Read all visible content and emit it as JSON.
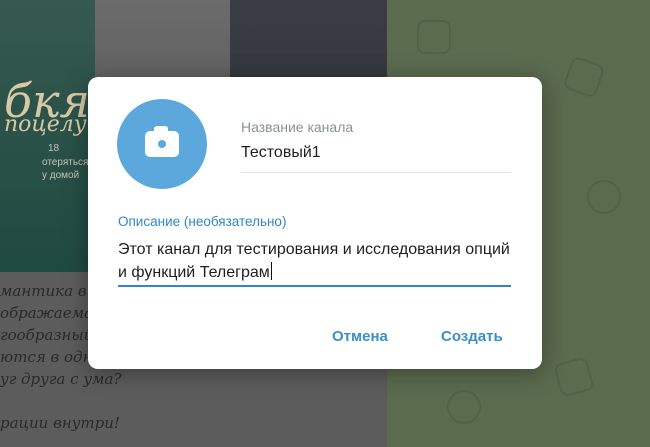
{
  "background": {
    "book_title_line1": "бкя",
    "book_title_line2": "поцелуй",
    "book_number": "18",
    "book_subtitle": "отеряться, чтоб\nу домой",
    "text_lines": [
      "мантика в д",
      "ображаемая",
      "гообразный",
      "ются в одн",
      "уг друга с ума?",
      "",
      "рации внутри!"
    ]
  },
  "dialog": {
    "avatar_icon": "camera-icon",
    "name_label": "Название канала",
    "name_value": "Тестовый1",
    "description_label": "Описание (необязательно)",
    "description_value": "Этот канал для тестирования и исследования опций и функций Телеграм",
    "cancel_label": "Отмена",
    "create_label": "Создать"
  },
  "colors": {
    "accent": "#3a8fc9",
    "avatar": "#5ca8dd",
    "label_gray": "#8a9199"
  }
}
